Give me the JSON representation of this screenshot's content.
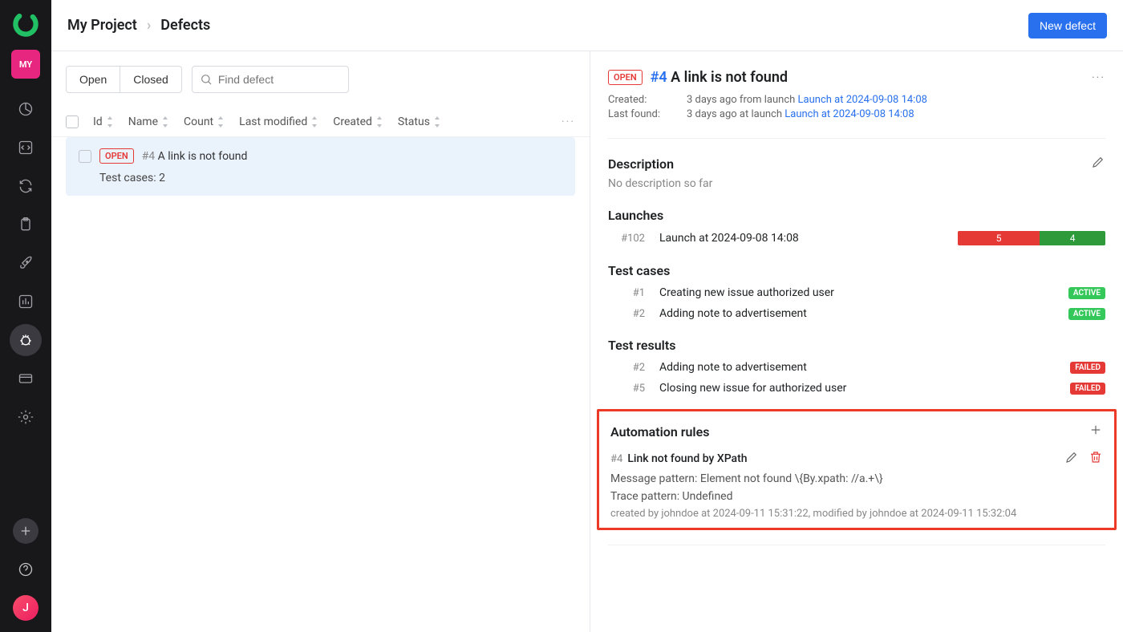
{
  "sidebar": {
    "project_badge": "MY",
    "avatar_initial": "J"
  },
  "header": {
    "breadcrumb": [
      "My Project",
      "Defects"
    ],
    "new_defect_label": "New defect"
  },
  "filters": {
    "open_label": "Open",
    "closed_label": "Closed",
    "search_placeholder": "Find defect"
  },
  "table": {
    "columns": [
      "Id",
      "Name",
      "Count",
      "Last modified",
      "Created",
      "Status"
    ]
  },
  "list_item": {
    "status_badge": "OPEN",
    "id": "#4",
    "title": "A link is not found",
    "testcases_label": "Test cases: ",
    "testcases_count": "2"
  },
  "detail": {
    "status_badge": "OPEN",
    "id": "#4",
    "title": "A link is not found",
    "created_label": "Created:",
    "created_value": "3 days ago from launch ",
    "created_link": "Launch at 2024-09-08 14:08",
    "lastfound_label": "Last found:",
    "lastfound_value": "3 days ago at launch ",
    "lastfound_link": "Launch at 2024-09-08 14:08"
  },
  "description": {
    "heading": "Description",
    "empty": "No description so far"
  },
  "launches": {
    "heading": "Launches",
    "items": [
      {
        "id": "#102",
        "name": "Launch at 2024-09-08 14:08",
        "red_count": "5",
        "green_count": "4"
      }
    ]
  },
  "testcases": {
    "heading": "Test cases",
    "items": [
      {
        "id": "#1",
        "name": "Creating new issue authorized user",
        "badge": "ACTIVE"
      },
      {
        "id": "#2",
        "name": "Adding note to advertisement",
        "badge": "ACTIVE"
      }
    ]
  },
  "testresults": {
    "heading": "Test results",
    "items": [
      {
        "id": "#2",
        "name": "Adding note to advertisement",
        "badge": "FAILED"
      },
      {
        "id": "#5",
        "name": "Closing new issue for authorized user",
        "badge": "FAILED"
      }
    ]
  },
  "automation": {
    "heading": "Automation rules",
    "rule_id": "#4",
    "rule_name": "Link not found by XPath",
    "message_pattern": "Message pattern: Element not found \\{By.xpath: //a.+\\}",
    "trace_pattern": "Trace pattern: Undefined",
    "meta": "created by johndoe at 2024-09-11 15:31:22, modified by johndoe at 2024-09-11 15:32:04"
  }
}
